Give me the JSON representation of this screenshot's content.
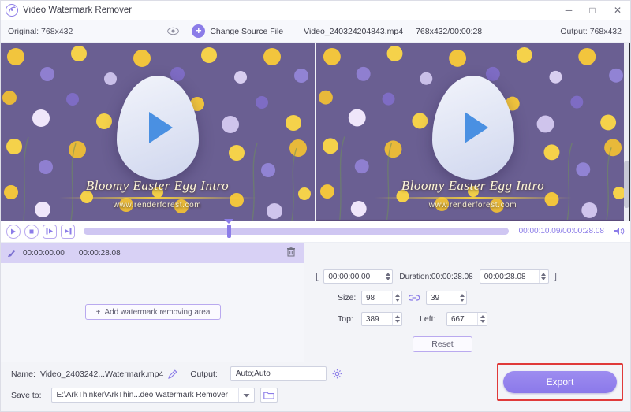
{
  "titlebar": {
    "app_title": "Video Watermark Remover",
    "logo_icon": "arkthinker-logo-icon",
    "minimize": "─",
    "maximize": "□",
    "close": "✕"
  },
  "sourcebar": {
    "original_label": "Original: 768x432",
    "eye_icon": "eye-icon",
    "change_source_label": "Change Source File",
    "plus_icon": "+",
    "file_name": "Video_240324204843.mp4",
    "file_time": "768x432/00:00:28",
    "output_label": "Output: 768x432"
  },
  "preview": {
    "watermark_title": "Bloomy Easter Egg Intro",
    "watermark_url": "www.renderforest.com",
    "play_icon": "play-icon"
  },
  "playback": {
    "play_icon": "play-icon",
    "stop_icon": "stop-icon",
    "mark_in_icon": "mark-in-icon",
    "mark_out_icon": "mark-out-icon",
    "time_readout": "00:00:10.09/00:00:28.08",
    "volume_icon": "volume-icon"
  },
  "timeline": {
    "brush_icon": "brush-icon",
    "start": "00:00:00.00",
    "end": "00:00:28.08",
    "delete_icon": "trash-icon"
  },
  "left_pane": {
    "add_area_label": "Add watermark removing area",
    "add_icon": "+"
  },
  "trim": {
    "bracket_left": "[",
    "bracket_right": "]",
    "start_value": "00:00:00.00",
    "duration_label": "Duration:00:00:28.08",
    "end_value": "00:00:28.08"
  },
  "area": {
    "size_label": "Size:",
    "size_w": "98",
    "size_h": "39",
    "link_icon": "link-icon",
    "top_label": "Top:",
    "top_value": "389",
    "left_label": "Left:",
    "left_value": "667",
    "reset_label": "Reset"
  },
  "bottom": {
    "name_label": "Name:",
    "name_value": "Video_2403242...Watermark.mp4",
    "edit_icon": "pencil-icon",
    "output_label": "Output:",
    "output_value": "Auto;Auto",
    "settings_icon": "gear-icon",
    "save_to_label": "Save to:",
    "save_to_value": "E:\\ArkThinker\\ArkThin...deo Watermark Remover",
    "dropdown_icon": "chevron-down-icon",
    "folder_icon": "folder-icon",
    "export_label": "Export"
  },
  "colors": {
    "accent": "#8b7ce8",
    "highlight_border": "#e03a3a",
    "timeline_band": "#d8d1f5"
  }
}
